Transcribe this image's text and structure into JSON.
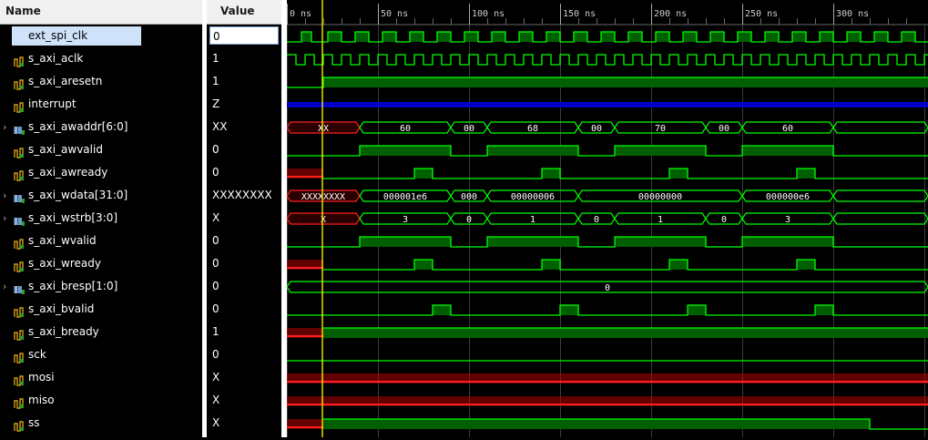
{
  "header": {
    "name_col": "Name",
    "value_col": "Value"
  },
  "time_axis": {
    "labels": [
      "0 ns",
      "50 ns",
      "100 ns",
      "150 ns",
      "200 ns",
      "250 ns",
      "300 ns"
    ],
    "cursor_ns": 19.5,
    "span_ns": 352
  },
  "colors": {
    "bus_green": "#00e600",
    "fill_green": "#005f00",
    "trace": "#00ff00",
    "x_red": "#b40000",
    "z_blue": "#0000c8",
    "cursor": "#ffff00"
  },
  "signals": [
    {
      "name": "ext_spi_clk",
      "value": "0",
      "bus": false,
      "icon": "wire-icon",
      "selected": true
    },
    {
      "name": "s_axi_aclk",
      "value": "1",
      "bus": false,
      "icon": "wire-icon"
    },
    {
      "name": "s_axi_aresetn",
      "value": "1",
      "bus": false,
      "icon": "wire-icon"
    },
    {
      "name": "interrupt",
      "value": "Z",
      "bus": false,
      "icon": "wire-icon"
    },
    {
      "name": "s_axi_awaddr[6:0]",
      "value": "XX",
      "bus": true,
      "icon": "bus-icon"
    },
    {
      "name": "s_axi_awvalid",
      "value": "0",
      "bus": false,
      "icon": "wire-icon"
    },
    {
      "name": "s_axi_awready",
      "value": "0",
      "bus": false,
      "icon": "wire-icon"
    },
    {
      "name": "s_axi_wdata[31:0]",
      "value": "XXXXXXXX",
      "bus": true,
      "icon": "bus-icon"
    },
    {
      "name": "s_axi_wstrb[3:0]",
      "value": "X",
      "bus": true,
      "icon": "bus-icon"
    },
    {
      "name": "s_axi_wvalid",
      "value": "0",
      "bus": false,
      "icon": "wire-icon"
    },
    {
      "name": "s_axi_wready",
      "value": "0",
      "bus": false,
      "icon": "wire-icon"
    },
    {
      "name": "s_axi_bresp[1:0]",
      "value": "0",
      "bus": true,
      "icon": "bus-icon"
    },
    {
      "name": "s_axi_bvalid",
      "value": "0",
      "bus": false,
      "icon": "wire-icon"
    },
    {
      "name": "s_axi_bready",
      "value": "1",
      "bus": false,
      "icon": "wire-icon"
    },
    {
      "name": "sck",
      "value": "0",
      "bus": false,
      "icon": "wire-icon"
    },
    {
      "name": "mosi",
      "value": "X",
      "bus": false,
      "icon": "wire-icon"
    },
    {
      "name": "miso",
      "value": "X",
      "bus": false,
      "icon": "wire-icon"
    },
    {
      "name": "ss",
      "value": "X",
      "bus": false,
      "icon": "wire-icon"
    }
  ],
  "waves": {
    "ext_spi_clk": {
      "kind": "bit",
      "segs": [
        [
          0,
          8,
          "0"
        ],
        [
          8,
          13.5,
          "1"
        ],
        [
          13.5,
          22.5,
          "0"
        ],
        [
          22.5,
          30,
          "1"
        ],
        [
          30,
          37.5,
          "0"
        ],
        [
          37.5,
          45,
          "1"
        ],
        [
          45,
          52.5,
          "0"
        ],
        [
          52.5,
          60,
          "1"
        ],
        [
          60,
          67.5,
          "0"
        ],
        [
          67.5,
          75,
          "1"
        ],
        [
          75,
          82.5,
          "0"
        ],
        [
          82.5,
          90,
          "1"
        ],
        [
          90,
          97.5,
          "0"
        ],
        [
          97.5,
          105,
          "1"
        ],
        [
          105,
          112.5,
          "0"
        ],
        [
          112.5,
          120,
          "1"
        ],
        [
          120,
          127.5,
          "0"
        ],
        [
          127.5,
          135,
          "1"
        ],
        [
          135,
          142.5,
          "0"
        ],
        [
          142.5,
          150,
          "1"
        ],
        [
          150,
          157.5,
          "0"
        ],
        [
          157.5,
          165,
          "1"
        ],
        [
          165,
          172.5,
          "0"
        ],
        [
          172.5,
          180,
          "1"
        ],
        [
          180,
          187.5,
          "0"
        ],
        [
          187.5,
          195,
          "1"
        ],
        [
          195,
          202.5,
          "0"
        ],
        [
          202.5,
          210,
          "1"
        ],
        [
          210,
          217.5,
          "0"
        ],
        [
          217.5,
          225,
          "1"
        ],
        [
          225,
          232.5,
          "0"
        ],
        [
          232.5,
          240,
          "1"
        ],
        [
          240,
          247.5,
          "0"
        ],
        [
          247.5,
          255,
          "1"
        ],
        [
          255,
          262.5,
          "0"
        ],
        [
          262.5,
          270,
          "1"
        ],
        [
          270,
          277.5,
          "0"
        ],
        [
          277.5,
          285,
          "1"
        ],
        [
          285,
          292.5,
          "0"
        ],
        [
          292.5,
          300,
          "1"
        ],
        [
          300,
          307.5,
          "0"
        ],
        [
          307.5,
          315,
          "1"
        ],
        [
          315,
          322.5,
          "0"
        ],
        [
          322.5,
          330,
          "1"
        ],
        [
          330,
          337.5,
          "0"
        ],
        [
          337.5,
          345,
          "1"
        ],
        [
          345,
          352,
          "0"
        ]
      ]
    },
    "s_axi_aclk": {
      "kind": "clock",
      "period_ns": 10,
      "high_first": true,
      "phase_ns": 0
    },
    "s_axi_aresetn": {
      "kind": "bit",
      "segs": [
        [
          0,
          20,
          "0"
        ],
        [
          20,
          352,
          "1"
        ]
      ]
    },
    "interrupt": {
      "kind": "bit",
      "segs": [
        [
          0,
          352,
          "Z"
        ]
      ]
    },
    "s_axi_awaddr[6:0]": {
      "kind": "bus",
      "segs": [
        [
          0,
          40,
          "XX",
          "x"
        ],
        [
          40,
          90,
          "60",
          "v"
        ],
        [
          90,
          110,
          "00",
          "v"
        ],
        [
          110,
          160,
          "68",
          "v"
        ],
        [
          160,
          180,
          "00",
          "v"
        ],
        [
          180,
          230,
          "70",
          "v"
        ],
        [
          230,
          250,
          "00",
          "v"
        ],
        [
          250,
          300,
          "60",
          "v"
        ],
        [
          300,
          352,
          "",
          "v"
        ]
      ]
    },
    "s_axi_awvalid": {
      "kind": "bit",
      "segs": [
        [
          0,
          40,
          "0"
        ],
        [
          40,
          90,
          "1"
        ],
        [
          90,
          110,
          "0"
        ],
        [
          110,
          160,
          "1"
        ],
        [
          160,
          180,
          "0"
        ],
        [
          180,
          230,
          "1"
        ],
        [
          230,
          250,
          "0"
        ],
        [
          250,
          300,
          "1"
        ],
        [
          300,
          352,
          "0"
        ]
      ]
    },
    "s_axi_awready": {
      "kind": "bit",
      "segs": [
        [
          0,
          20,
          "X"
        ],
        [
          20,
          70,
          "0"
        ],
        [
          70,
          80,
          "1"
        ],
        [
          80,
          140,
          "0"
        ],
        [
          140,
          150,
          "1"
        ],
        [
          150,
          210,
          "0"
        ],
        [
          210,
          220,
          "1"
        ],
        [
          220,
          280,
          "0"
        ],
        [
          280,
          290,
          "1"
        ],
        [
          290,
          352,
          "0"
        ]
      ]
    },
    "s_axi_wdata[31:0]": {
      "kind": "bus",
      "segs": [
        [
          0,
          40,
          "XXXXXXXX",
          "x"
        ],
        [
          40,
          90,
          "000001e6",
          "v"
        ],
        [
          90,
          110,
          "000",
          "v"
        ],
        [
          110,
          160,
          "00000006",
          "v"
        ],
        [
          160,
          250,
          "00000000",
          "v"
        ],
        [
          250,
          300,
          "000000e6",
          "v"
        ],
        [
          300,
          352,
          "",
          "v"
        ]
      ]
    },
    "s_axi_wstrb[3:0]": {
      "kind": "bus",
      "segs": [
        [
          0,
          40,
          "X",
          "x"
        ],
        [
          40,
          90,
          "3",
          "v"
        ],
        [
          90,
          110,
          "0",
          "v"
        ],
        [
          110,
          160,
          "1",
          "v"
        ],
        [
          160,
          180,
          "0",
          "v"
        ],
        [
          180,
          230,
          "1",
          "v"
        ],
        [
          230,
          250,
          "0",
          "v"
        ],
        [
          250,
          300,
          "3",
          "v"
        ],
        [
          300,
          352,
          "",
          "v"
        ]
      ]
    },
    "s_axi_wvalid": {
      "kind": "bit",
      "segs": [
        [
          0,
          40,
          "0"
        ],
        [
          40,
          90,
          "1"
        ],
        [
          90,
          110,
          "0"
        ],
        [
          110,
          160,
          "1"
        ],
        [
          160,
          180,
          "0"
        ],
        [
          180,
          230,
          "1"
        ],
        [
          230,
          250,
          "0"
        ],
        [
          250,
          300,
          "1"
        ],
        [
          300,
          352,
          "0"
        ]
      ]
    },
    "s_axi_wready": {
      "kind": "bit",
      "segs": [
        [
          0,
          20,
          "X"
        ],
        [
          20,
          70,
          "0"
        ],
        [
          70,
          80,
          "1"
        ],
        [
          80,
          140,
          "0"
        ],
        [
          140,
          150,
          "1"
        ],
        [
          150,
          210,
          "0"
        ],
        [
          210,
          220,
          "1"
        ],
        [
          220,
          280,
          "0"
        ],
        [
          280,
          290,
          "1"
        ],
        [
          290,
          352,
          "0"
        ]
      ]
    },
    "s_axi_bresp[1:0]": {
      "kind": "bus",
      "segs": [
        [
          0,
          352,
          "0",
          "v"
        ]
      ]
    },
    "s_axi_bvalid": {
      "kind": "bit",
      "segs": [
        [
          0,
          80,
          "0"
        ],
        [
          80,
          90,
          "1"
        ],
        [
          90,
          150,
          "0"
        ],
        [
          150,
          160,
          "1"
        ],
        [
          160,
          220,
          "0"
        ],
        [
          220,
          230,
          "1"
        ],
        [
          230,
          290,
          "0"
        ],
        [
          290,
          300,
          "1"
        ],
        [
          300,
          352,
          "0"
        ]
      ]
    },
    "s_axi_bready": {
      "kind": "bit",
      "segs": [
        [
          0,
          20,
          "X"
        ],
        [
          20,
          352,
          "1"
        ]
      ]
    },
    "sck": {
      "kind": "bit",
      "segs": [
        [
          0,
          352,
          "0"
        ]
      ]
    },
    "mosi": {
      "kind": "bit",
      "segs": [
        [
          0,
          352,
          "X"
        ]
      ]
    },
    "miso": {
      "kind": "bit",
      "segs": [
        [
          0,
          352,
          "X"
        ]
      ]
    },
    "ss": {
      "kind": "bit",
      "segs": [
        [
          0,
          20,
          "X"
        ],
        [
          20,
          320,
          "1"
        ],
        [
          320,
          352,
          "0"
        ]
      ]
    }
  }
}
